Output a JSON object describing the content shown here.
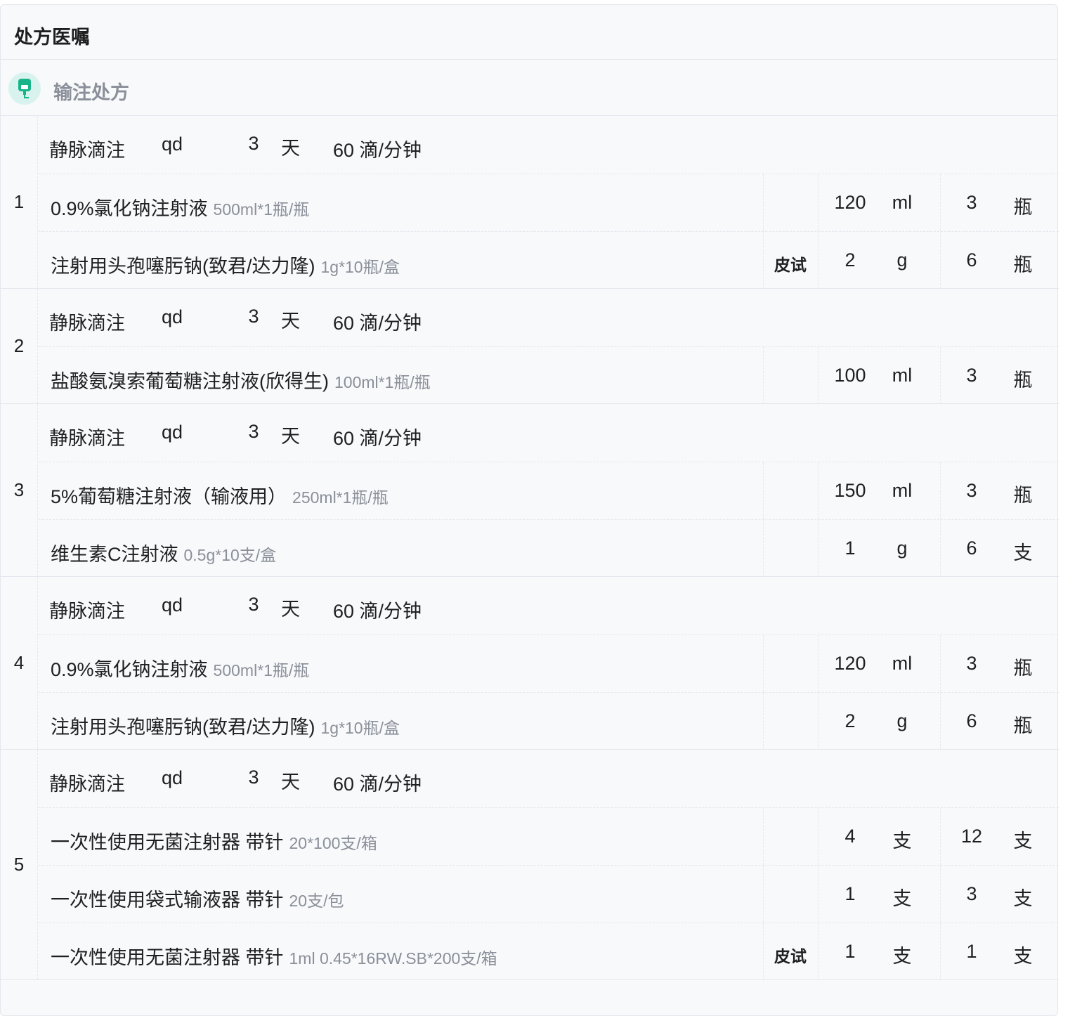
{
  "panel_title": "处方医嘱",
  "section": {
    "title": "输注处方",
    "icon": "iv-drip-icon",
    "icon_color": "#19b38a"
  },
  "groups": [
    {
      "num": "1",
      "route": "静脉滴注",
      "freq": "qd",
      "days": "3",
      "days_unit": "天",
      "rate": "60 滴/分钟",
      "drugs": [
        {
          "name": "0.9%氯化钠注射液",
          "spec": "500ml*1瓶/瓶",
          "skin": "",
          "dose": "120",
          "dose_unit": "ml",
          "qty": "3",
          "qty_unit": "瓶"
        },
        {
          "name": "注射用头孢噻肟钠(致君/达力隆)",
          "spec": "1g*10瓶/盒",
          "skin": "皮试",
          "dose": "2",
          "dose_unit": "g",
          "qty": "6",
          "qty_unit": "瓶"
        }
      ]
    },
    {
      "num": "2",
      "route": "静脉滴注",
      "freq": "qd",
      "days": "3",
      "days_unit": "天",
      "rate": "60 滴/分钟",
      "drugs": [
        {
          "name": "盐酸氨溴索葡萄糖注射液(欣得生)",
          "spec": "100ml*1瓶/瓶",
          "skin": "",
          "dose": "100",
          "dose_unit": "ml",
          "qty": "3",
          "qty_unit": "瓶"
        }
      ]
    },
    {
      "num": "3",
      "route": "静脉滴注",
      "freq": "qd",
      "days": "3",
      "days_unit": "天",
      "rate": "60 滴/分钟",
      "drugs": [
        {
          "name": "5%葡萄糖注射液（输液用）",
          "spec": "250ml*1瓶/瓶",
          "skin": "",
          "dose": "150",
          "dose_unit": "ml",
          "qty": "3",
          "qty_unit": "瓶"
        },
        {
          "name": "维生素C注射液",
          "spec": "0.5g*10支/盒",
          "skin": "",
          "dose": "1",
          "dose_unit": "g",
          "qty": "6",
          "qty_unit": "支"
        }
      ]
    },
    {
      "num": "4",
      "route": "静脉滴注",
      "freq": "qd",
      "days": "3",
      "days_unit": "天",
      "rate": "60 滴/分钟",
      "drugs": [
        {
          "name": "0.9%氯化钠注射液",
          "spec": "500ml*1瓶/瓶",
          "skin": "",
          "dose": "120",
          "dose_unit": "ml",
          "qty": "3",
          "qty_unit": "瓶"
        },
        {
          "name": "注射用头孢噻肟钠(致君/达力隆)",
          "spec": "1g*10瓶/盒",
          "skin": "",
          "dose": "2",
          "dose_unit": "g",
          "qty": "6",
          "qty_unit": "瓶"
        }
      ]
    },
    {
      "num": "5",
      "route": "静脉滴注",
      "freq": "qd",
      "days": "3",
      "days_unit": "天",
      "rate": "60 滴/分钟",
      "drugs": [
        {
          "name": "一次性使用无菌注射器 带针",
          "spec": "20*100支/箱",
          "skin": "",
          "dose": "4",
          "dose_unit": "支",
          "qty": "12",
          "qty_unit": "支"
        },
        {
          "name": "一次性使用袋式输液器 带针",
          "spec": "20支/包",
          "skin": "",
          "dose": "1",
          "dose_unit": "支",
          "qty": "3",
          "qty_unit": "支"
        },
        {
          "name": "一次性使用无菌注射器 带针",
          "spec": "1ml 0.45*16RW.SB*200支/箱",
          "skin": "皮试",
          "dose": "1",
          "dose_unit": "支",
          "qty": "1",
          "qty_unit": "支"
        }
      ]
    }
  ]
}
